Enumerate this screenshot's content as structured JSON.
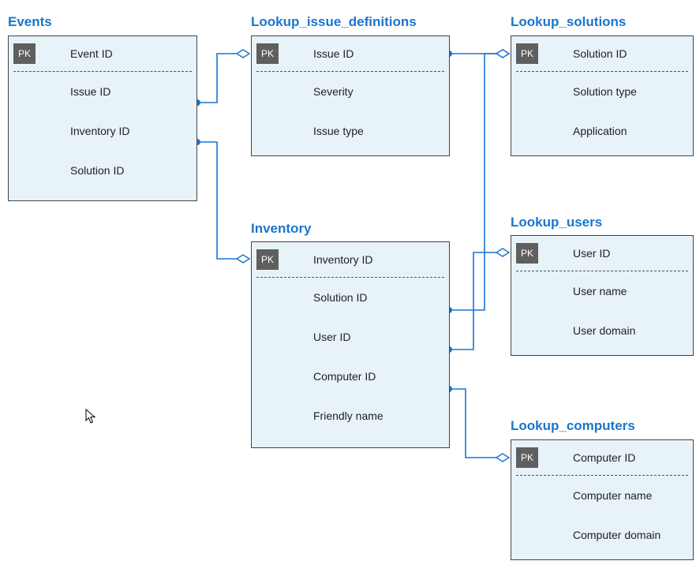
{
  "entities": {
    "events": {
      "title": "Events",
      "pk": "Event ID",
      "fields": [
        "Issue ID",
        "Inventory ID",
        "Solution ID"
      ]
    },
    "lookup_issue_definitions": {
      "title": "Lookup_issue_definitions",
      "pk": "Issue ID",
      "fields": [
        "Severity",
        "Issue type"
      ]
    },
    "lookup_solutions": {
      "title": "Lookup_solutions",
      "pk": "Solution ID",
      "fields": [
        "Solution type",
        "Application"
      ]
    },
    "inventory": {
      "title": "Inventory",
      "pk": "Inventory ID",
      "fields": [
        "Solution ID",
        "User ID",
        "Computer ID",
        "Friendly name"
      ]
    },
    "lookup_users": {
      "title": "Lookup_users",
      "pk": "User ID",
      "fields": [
        "User name",
        "User domain"
      ]
    },
    "lookup_computers": {
      "title": "Lookup_computers",
      "pk": "Computer ID",
      "fields": [
        "Computer name",
        "Computer domain"
      ]
    }
  },
  "pk_label": "PK",
  "colors": {
    "title": "#1a75cf",
    "entity_bg": "#e8f2f9",
    "connector": "#1a75cf"
  }
}
